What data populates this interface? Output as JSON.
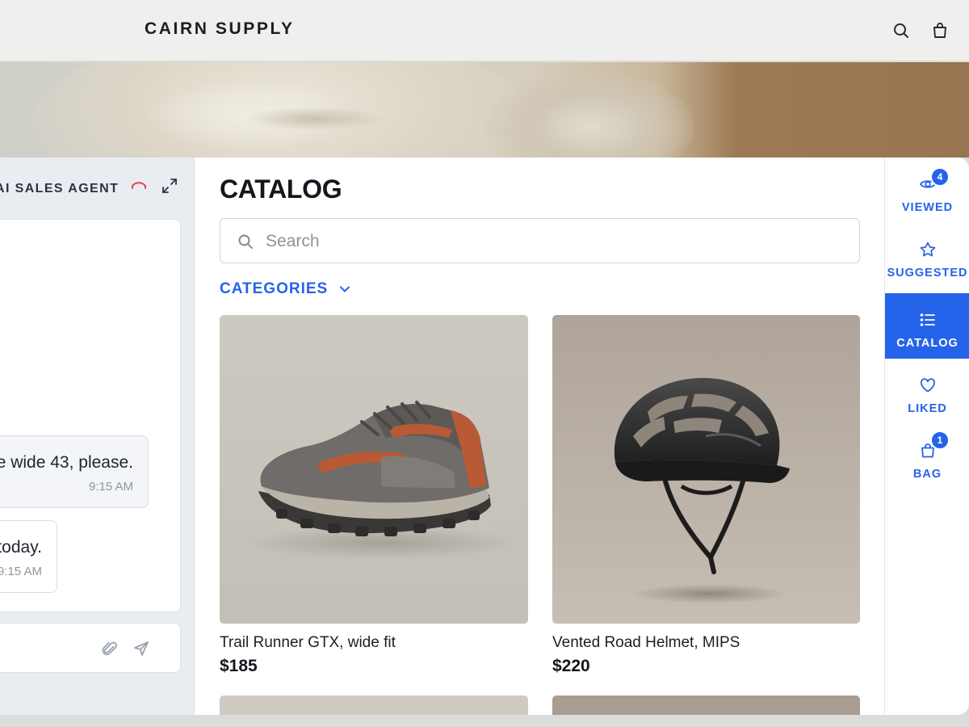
{
  "header": {
    "brand": "CAIRN SUPPLY",
    "icons": [
      "search-icon",
      "shopping-bag-icon"
    ]
  },
  "chat": {
    "title": "AI SALES AGENT",
    "messages": [
      {
        "role": "user",
        "text": "ne wide 43, please.",
        "time": "9:15 AM"
      },
      {
        "role": "agent",
        "text": "s today.",
        "time": "9:15 AM"
      }
    ],
    "composer_placeholder": "",
    "icons": [
      "hang-up-icon",
      "expand-icon",
      "attach-icon",
      "send-icon"
    ]
  },
  "catalog": {
    "title": "CATALOG",
    "search_placeholder": "Search",
    "categories_label": "CATEGORIES",
    "products": [
      {
        "name": "Trail Runner GTX, wide fit",
        "price": "$185"
      },
      {
        "name": "Vented Road Helmet, MIPS",
        "price": "$220"
      }
    ]
  },
  "rail": {
    "items": [
      {
        "label": "VIEWED",
        "icon": "eye-icon",
        "badge": "4"
      },
      {
        "label": "SUGGESTED",
        "icon": "star-icon"
      },
      {
        "label": "CATALOG",
        "icon": "list-icon",
        "active": true
      },
      {
        "label": "LIKED",
        "icon": "heart-icon"
      },
      {
        "label": "BAG",
        "icon": "bag-icon",
        "badge": "1"
      }
    ]
  },
  "colors": {
    "accent": "#2563eb",
    "hangup": "#e5484d"
  }
}
